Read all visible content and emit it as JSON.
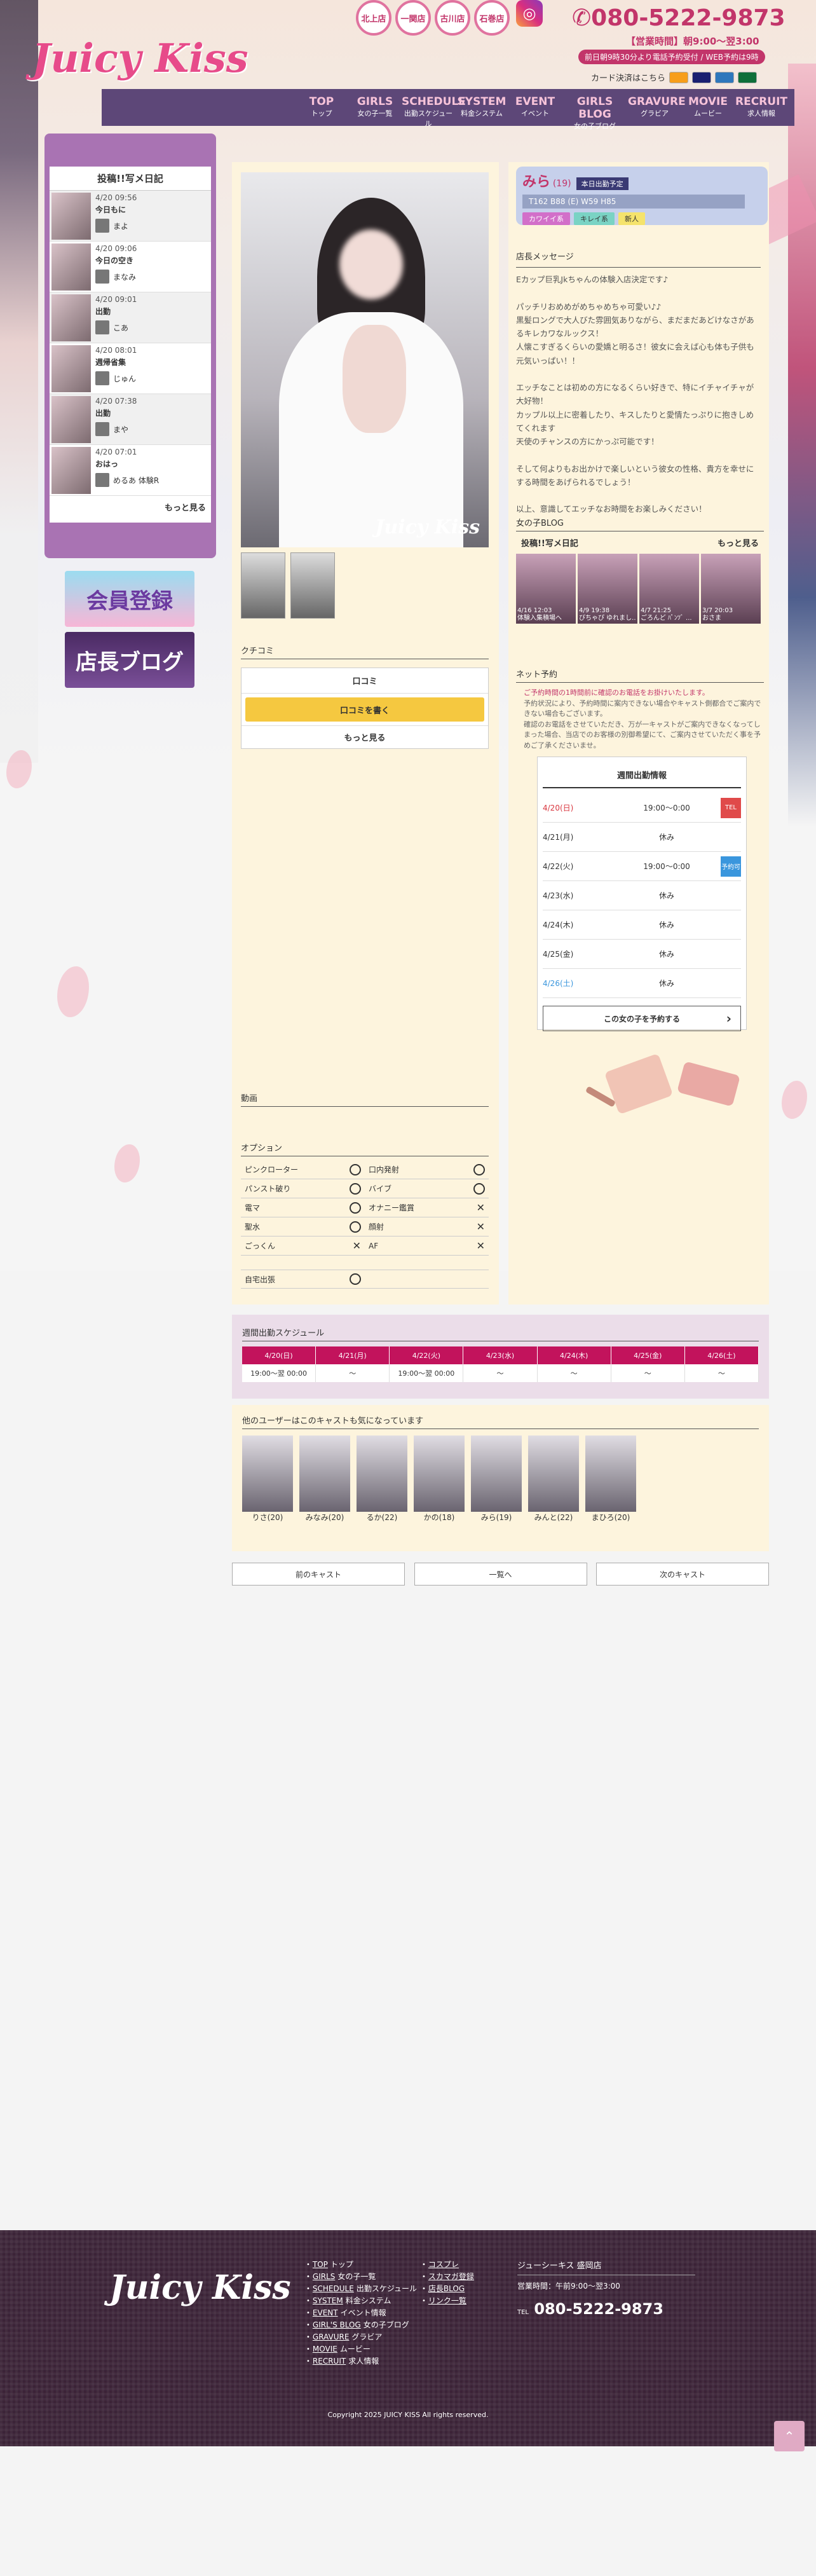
{
  "header": {
    "logo": "Juicy Kiss",
    "areas": [
      "北上店",
      "一関店",
      "古川店",
      "石巻店"
    ],
    "phone": "080-5222-9873",
    "hours_label": "【営業時間】朝9:00～翌3:00",
    "sub_note": "前日朝9時30分より電話予約受付 / WEB予約は9時",
    "card_note": "カード決済はこちら"
  },
  "nav": [
    {
      "en": "TOP",
      "jp": "トップ"
    },
    {
      "en": "GIRLS",
      "jp": "女の子一覧"
    },
    {
      "en": "SCHEDULE",
      "jp": "出勤スケジュール"
    },
    {
      "en": "SYSTEM",
      "jp": "料金システム"
    },
    {
      "en": "EVENT",
      "jp": "イベント"
    },
    {
      "en": "GIRLS BLOG",
      "jp": "女の子ブログ"
    },
    {
      "en": "GRAVURE",
      "jp": "グラビア"
    },
    {
      "en": "MOVIE",
      "jp": "ムービー"
    },
    {
      "en": "RECRUIT",
      "jp": "求人情報"
    }
  ],
  "sidebar": {
    "title": "投稿!!写メ日記",
    "entries": [
      {
        "date": "4/20 09:56",
        "title": "今日もに",
        "name": "まよ"
      },
      {
        "date": "4/20 09:06",
        "title": "今日の空き",
        "name": "まなみ"
      },
      {
        "date": "4/20 09:01",
        "title": "出勤",
        "name": "こあ"
      },
      {
        "date": "4/20 08:01",
        "title": "週帰省集",
        "name": "じゅん"
      },
      {
        "date": "4/20 07:38",
        "title": "出勤",
        "name": "まや"
      },
      {
        "date": "4/20 07:01",
        "title": "おはっ",
        "name": "めるあ 体験R"
      }
    ],
    "more": "もっと見る",
    "banner1": "会員登録",
    "banner2": "店長ブログ"
  },
  "cast": {
    "name": "みら",
    "age": "(19)",
    "status": "本日出勤予定",
    "size": "T162 B88 (E) W59 H85",
    "tags": [
      "カワイイ系",
      "キレイ系",
      "新人"
    ],
    "watermark": "Juicy Kiss"
  },
  "kuchikomi": {
    "label": "クチコミ",
    "heading": "口コミ",
    "write": "口コミを書く",
    "more": "もっと見る"
  },
  "movie_label": "動画",
  "options": {
    "label": "オプション",
    "rows": [
      {
        "a": "ピンクローター",
        "am": "o",
        "b": "口内発射",
        "bm": "o"
      },
      {
        "a": "パンスト破り",
        "am": "o",
        "b": "バイブ",
        "bm": "o"
      },
      {
        "a": "電マ",
        "am": "o",
        "b": "オナニー鑑賞",
        "bm": "x"
      },
      {
        "a": "聖水",
        "am": "o",
        "b": "顔射",
        "bm": "x"
      },
      {
        "a": "ごっくん",
        "am": "x",
        "b": "AF",
        "bm": "x"
      }
    ],
    "home": "自宅出張"
  },
  "message": {
    "label": "店長メッセージ",
    "text": "Eカップ巨乳Jkちゃんの体験入店決定です♪\n\nパッチリおめめがめちゃめちゃ可愛い♪♪\n黒髪ロングで大人びた雰囲気ありながら、まだまだあどけなさがあるキレカワなルックス！\n人懐こすぎるくらいの愛嬌と明るさ！彼女に会えば心も体も子供も元気いっぱい！！\n\nエッチなことは初めの方になるくらい好きで、特にイチャイチャが大好物！\nカップル以上に密着したり、キスしたりと愛情たっぷりに抱きしめてくれます\n天使のチャンスの方にかっぷ可能です！\n\nそして何よりもお出かけで楽しいという彼女の性格、貴方を幸せにする時間をあげられるでしょう！\n\n以上、意識してエッチなお時間をお楽しみください！"
  },
  "blog": {
    "label": "女の子BLOG",
    "heading": "投稿!!写メ日記",
    "more": "もっと見る",
    "items": [
      {
        "date": "4/16 12:03",
        "title": "体験入集積場へ"
      },
      {
        "date": "4/9 19:38",
        "title": "びちゃぴ ゆれまし.."
      },
      {
        "date": "4/7 21:25",
        "title": "ごろんど ﾊﾟﾝﾂﾞ ..."
      },
      {
        "date": "3/7 20:03",
        "title": "おさま"
      }
    ]
  },
  "net": {
    "label": "ネット予約",
    "notes": [
      "ご予約時間の1時間前に確認のお電話をお掛けいたします。",
      "予約状況により、予約時間に案内できない場合やキャスト側都合でご案内できない場合もございます。",
      "確認のお電話をさせていただき、万が一キャストがご案内できなくなってしまった場合、当店でのお客様の別御希望にて、ご案内させていただく事を予めご了承くださいませ。"
    ],
    "week_title": "週間出勤情報",
    "days": [
      {
        "d": "4/20(日)",
        "h": "19:00〜0:00",
        "b": "TEL",
        "c": "#e04a4a",
        "dc": "#d9363e"
      },
      {
        "d": "4/21(月)",
        "h": "休み",
        "b": "",
        "c": "",
        "dc": "#333"
      },
      {
        "d": "4/22(火)",
        "h": "19:00〜0:00",
        "b": "予約可",
        "c": "#3a96dd",
        "dc": "#333"
      },
      {
        "d": "4/23(水)",
        "h": "休み",
        "b": "",
        "c": "",
        "dc": "#333"
      },
      {
        "d": "4/24(木)",
        "h": "休み",
        "b": "",
        "c": "",
        "dc": "#333"
      },
      {
        "d": "4/25(金)",
        "h": "休み",
        "b": "",
        "c": "",
        "dc": "#333"
      },
      {
        "d": "4/26(土)",
        "h": "休み",
        "b": "",
        "c": "",
        "dc": "#3a96dd"
      }
    ],
    "reserve": "この女の子を予約する"
  },
  "schedule": {
    "label": "週間出勤スケジュール",
    "cols": [
      {
        "d": "4/20(日)",
        "v": "19:00〜翌 00:00"
      },
      {
        "d": "4/21(月)",
        "v": "〜"
      },
      {
        "d": "4/22(火)",
        "v": "19:00〜翌 00:00"
      },
      {
        "d": "4/23(水)",
        "v": "〜"
      },
      {
        "d": "4/24(木)",
        "v": "〜"
      },
      {
        "d": "4/25(金)",
        "v": "〜"
      },
      {
        "d": "4/26(土)",
        "v": "〜"
      }
    ]
  },
  "others": {
    "label": "他のユーザーはこのキャストも気になっています",
    "cast": [
      "りさ(20)",
      "みなみ(20)",
      "るか(22)",
      "かの(18)",
      "みら(19)",
      "みんと(22)",
      "まひろ(20)"
    ]
  },
  "pager": {
    "prev": "前のキャスト",
    "list": "一覧へ",
    "next": "次のキャスト"
  },
  "footer": {
    "logo": "Juicy Kiss",
    "links1": [
      {
        "en": "TOP",
        "jp": "トップ"
      },
      {
        "en": "GIRLS",
        "jp": "女の子一覧"
      },
      {
        "en": "SCHEDULE",
        "jp": "出勤スケジュール"
      },
      {
        "en": "SYSTEM",
        "jp": "料金システム"
      },
      {
        "en": "EVENT",
        "jp": "イベント情報"
      },
      {
        "en": "GIRL'S BLOG",
        "jp": "女の子ブログ"
      },
      {
        "en": "GRAVURE",
        "jp": "グラビア"
      },
      {
        "en": "MOVIE",
        "jp": "ムービー"
      },
      {
        "en": "RECRUIT",
        "jp": "求人情報"
      }
    ],
    "links2": [
      "コスプレ",
      "スカマガ登録",
      "店長BLOG",
      "リンク一覧"
    ],
    "shop": "ジューシーキス 盛岡店",
    "hours": "営業時間：午前9:00〜翌3:00",
    "tel_label": "TEL",
    "tel": "080-5222-9873",
    "copyright": "Copyright 2025 JUICY KISS All rights reserved."
  },
  "colors": {
    "accent": "#c2356a",
    "nav": "#5d4778",
    "panel": "#fdf4dd"
  }
}
